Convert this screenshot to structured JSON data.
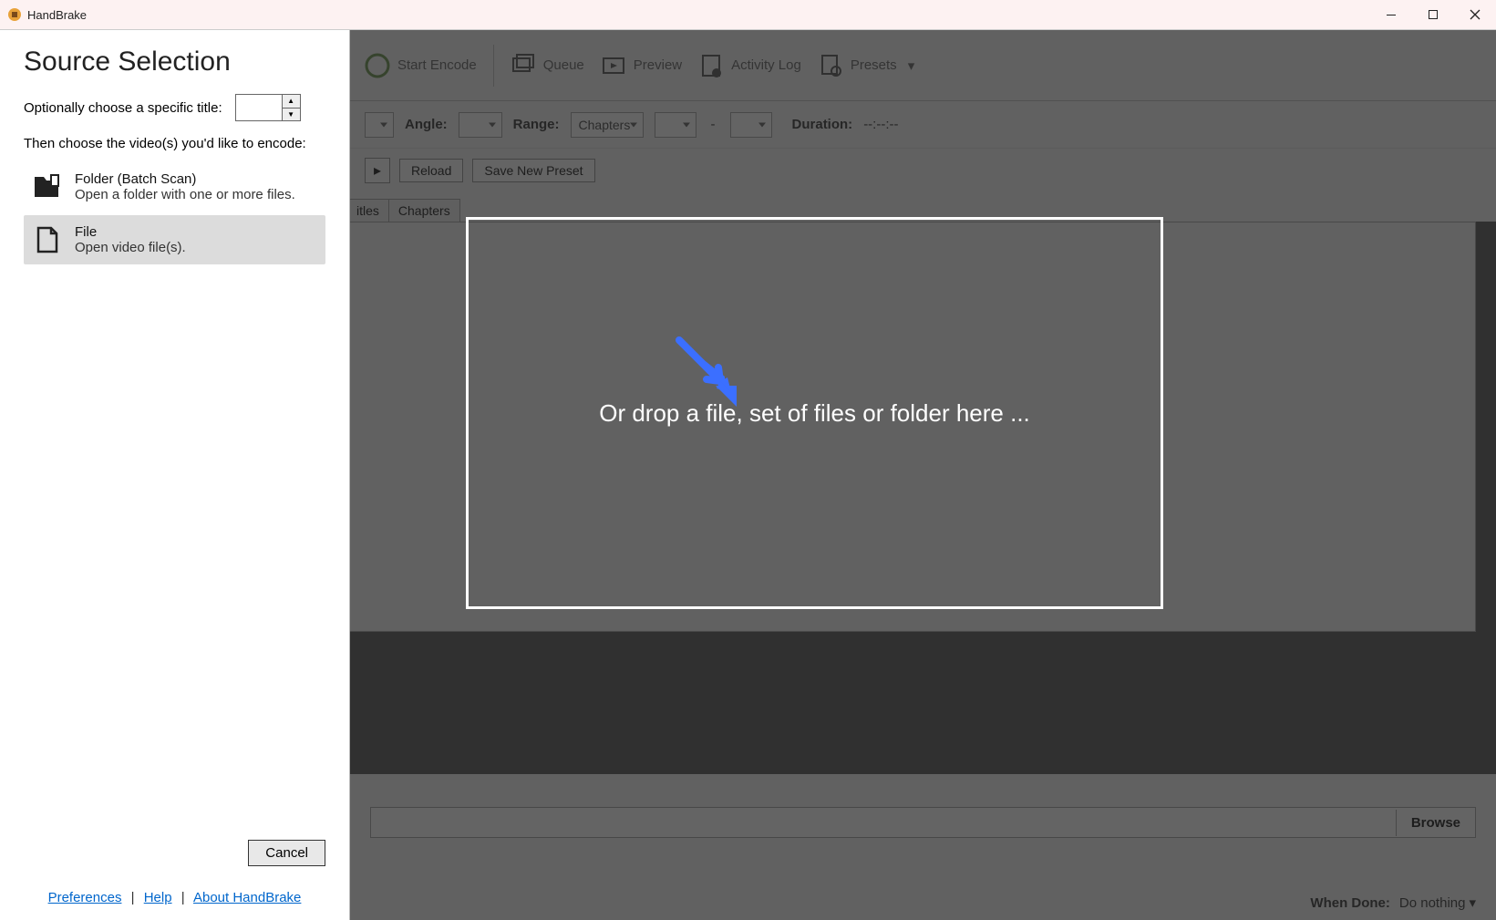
{
  "app": {
    "title": "HandBrake"
  },
  "toolbar": {
    "start_encode": "Start Encode",
    "queue": "Queue",
    "preview": "Preview",
    "activity_log": "Activity Log",
    "presets": "Presets"
  },
  "form": {
    "angle_label": "Angle:",
    "range_label": "Range:",
    "range_value": "Chapters",
    "duration_label": "Duration:",
    "duration_value": "--:--:--",
    "reload": "Reload",
    "save_preset": "Save New Preset",
    "tab_titles": "itles",
    "tab_chapters": "Chapters"
  },
  "bottom": {
    "browse": "Browse",
    "when_done_label": "When Done:",
    "when_done_value": "Do nothing"
  },
  "panel": {
    "heading": "Source Selection",
    "title_label": "Optionally choose a specific title:",
    "instruction": "Then choose the video(s) you'd like to encode:",
    "folder": {
      "title": "Folder (Batch Scan)",
      "desc": "Open a folder with one or more files."
    },
    "file": {
      "title": "File",
      "desc": "Open video file(s)."
    },
    "cancel": "Cancel",
    "links": {
      "preferences": "Preferences",
      "help": "Help",
      "about": "About HandBrake"
    }
  },
  "dropzone": {
    "text": "Or drop a file, set of files or folder here ..."
  }
}
